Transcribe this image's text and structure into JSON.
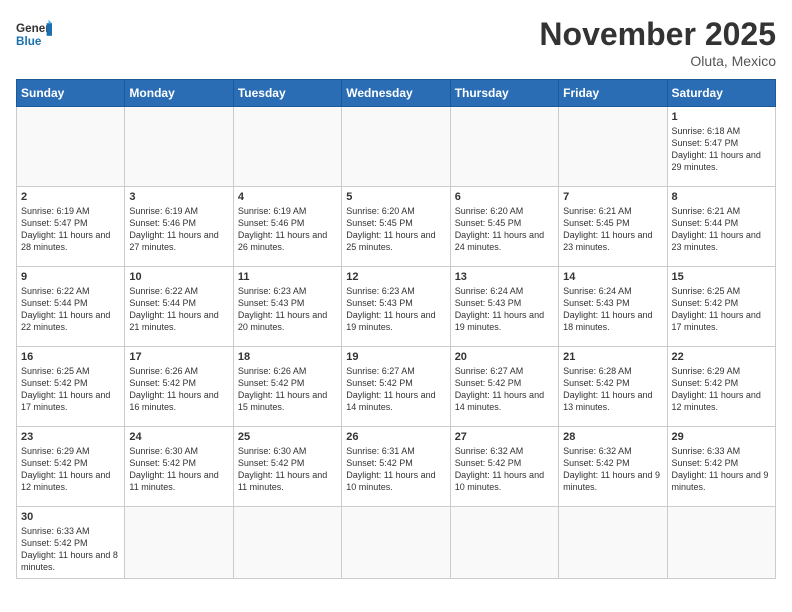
{
  "header": {
    "logo_general": "General",
    "logo_blue": "Blue",
    "month_title": "November 2025",
    "subtitle": "Oluta, Mexico"
  },
  "days_of_week": [
    "Sunday",
    "Monday",
    "Tuesday",
    "Wednesday",
    "Thursday",
    "Friday",
    "Saturday"
  ],
  "weeks": [
    {
      "days": [
        {
          "num": "",
          "content": ""
        },
        {
          "num": "",
          "content": ""
        },
        {
          "num": "",
          "content": ""
        },
        {
          "num": "",
          "content": ""
        },
        {
          "num": "",
          "content": ""
        },
        {
          "num": "",
          "content": ""
        },
        {
          "num": "1",
          "content": "Sunrise: 6:18 AM\nSunset: 5:47 PM\nDaylight: 11 hours\nand 29 minutes."
        }
      ]
    },
    {
      "days": [
        {
          "num": "2",
          "content": "Sunrise: 6:19 AM\nSunset: 5:47 PM\nDaylight: 11 hours\nand 28 minutes."
        },
        {
          "num": "3",
          "content": "Sunrise: 6:19 AM\nSunset: 5:46 PM\nDaylight: 11 hours\nand 27 minutes."
        },
        {
          "num": "4",
          "content": "Sunrise: 6:19 AM\nSunset: 5:46 PM\nDaylight: 11 hours\nand 26 minutes."
        },
        {
          "num": "5",
          "content": "Sunrise: 6:20 AM\nSunset: 5:45 PM\nDaylight: 11 hours\nand 25 minutes."
        },
        {
          "num": "6",
          "content": "Sunrise: 6:20 AM\nSunset: 5:45 PM\nDaylight: 11 hours\nand 24 minutes."
        },
        {
          "num": "7",
          "content": "Sunrise: 6:21 AM\nSunset: 5:45 PM\nDaylight: 11 hours\nand 23 minutes."
        },
        {
          "num": "8",
          "content": "Sunrise: 6:21 AM\nSunset: 5:44 PM\nDaylight: 11 hours\nand 23 minutes."
        }
      ]
    },
    {
      "days": [
        {
          "num": "9",
          "content": "Sunrise: 6:22 AM\nSunset: 5:44 PM\nDaylight: 11 hours\nand 22 minutes."
        },
        {
          "num": "10",
          "content": "Sunrise: 6:22 AM\nSunset: 5:44 PM\nDaylight: 11 hours\nand 21 minutes."
        },
        {
          "num": "11",
          "content": "Sunrise: 6:23 AM\nSunset: 5:43 PM\nDaylight: 11 hours\nand 20 minutes."
        },
        {
          "num": "12",
          "content": "Sunrise: 6:23 AM\nSunset: 5:43 PM\nDaylight: 11 hours\nand 19 minutes."
        },
        {
          "num": "13",
          "content": "Sunrise: 6:24 AM\nSunset: 5:43 PM\nDaylight: 11 hours\nand 19 minutes."
        },
        {
          "num": "14",
          "content": "Sunrise: 6:24 AM\nSunset: 5:43 PM\nDaylight: 11 hours\nand 18 minutes."
        },
        {
          "num": "15",
          "content": "Sunrise: 6:25 AM\nSunset: 5:42 PM\nDaylight: 11 hours\nand 17 minutes."
        }
      ]
    },
    {
      "days": [
        {
          "num": "16",
          "content": "Sunrise: 6:25 AM\nSunset: 5:42 PM\nDaylight: 11 hours\nand 17 minutes."
        },
        {
          "num": "17",
          "content": "Sunrise: 6:26 AM\nSunset: 5:42 PM\nDaylight: 11 hours\nand 16 minutes."
        },
        {
          "num": "18",
          "content": "Sunrise: 6:26 AM\nSunset: 5:42 PM\nDaylight: 11 hours\nand 15 minutes."
        },
        {
          "num": "19",
          "content": "Sunrise: 6:27 AM\nSunset: 5:42 PM\nDaylight: 11 hours\nand 14 minutes."
        },
        {
          "num": "20",
          "content": "Sunrise: 6:27 AM\nSunset: 5:42 PM\nDaylight: 11 hours\nand 14 minutes."
        },
        {
          "num": "21",
          "content": "Sunrise: 6:28 AM\nSunset: 5:42 PM\nDaylight: 11 hours\nand 13 minutes."
        },
        {
          "num": "22",
          "content": "Sunrise: 6:29 AM\nSunset: 5:42 PM\nDaylight: 11 hours\nand 12 minutes."
        }
      ]
    },
    {
      "days": [
        {
          "num": "23",
          "content": "Sunrise: 6:29 AM\nSunset: 5:42 PM\nDaylight: 11 hours\nand 12 minutes."
        },
        {
          "num": "24",
          "content": "Sunrise: 6:30 AM\nSunset: 5:42 PM\nDaylight: 11 hours\nand 11 minutes."
        },
        {
          "num": "25",
          "content": "Sunrise: 6:30 AM\nSunset: 5:42 PM\nDaylight: 11 hours\nand 11 minutes."
        },
        {
          "num": "26",
          "content": "Sunrise: 6:31 AM\nSunset: 5:42 PM\nDaylight: 11 hours\nand 10 minutes."
        },
        {
          "num": "27",
          "content": "Sunrise: 6:32 AM\nSunset: 5:42 PM\nDaylight: 11 hours\nand 10 minutes."
        },
        {
          "num": "28",
          "content": "Sunrise: 6:32 AM\nSunset: 5:42 PM\nDaylight: 11 hours\nand 9 minutes."
        },
        {
          "num": "29",
          "content": "Sunrise: 6:33 AM\nSunset: 5:42 PM\nDaylight: 11 hours\nand 9 minutes."
        }
      ]
    },
    {
      "days": [
        {
          "num": "30",
          "content": "Sunrise: 6:33 AM\nSunset: 5:42 PM\nDaylight: 11 hours\nand 8 minutes."
        },
        {
          "num": "",
          "content": ""
        },
        {
          "num": "",
          "content": ""
        },
        {
          "num": "",
          "content": ""
        },
        {
          "num": "",
          "content": ""
        },
        {
          "num": "",
          "content": ""
        },
        {
          "num": "",
          "content": ""
        }
      ]
    }
  ]
}
